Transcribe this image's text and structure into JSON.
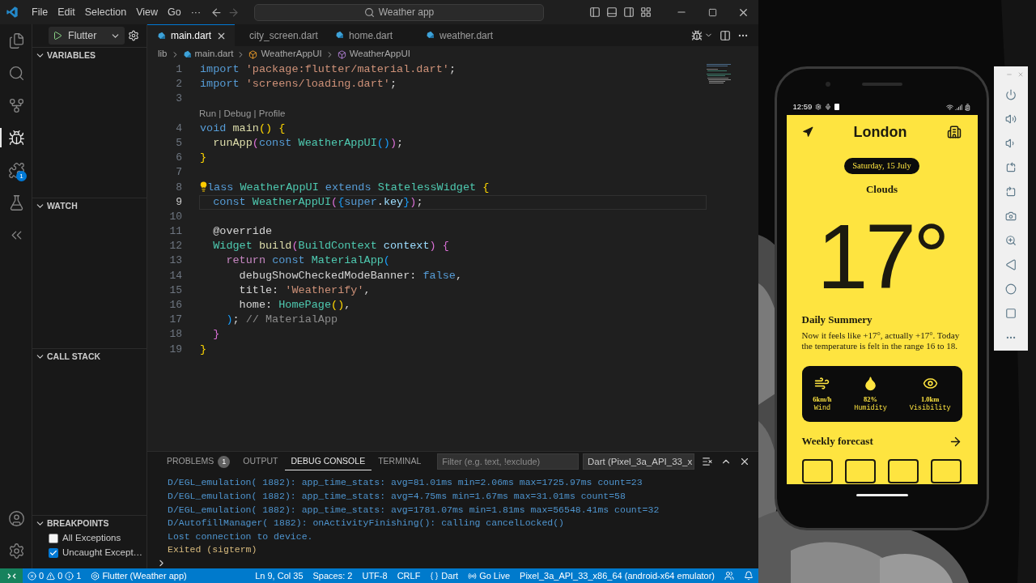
{
  "title_bar": {
    "menus": [
      "File",
      "Edit",
      "Selection",
      "View",
      "Go",
      "···"
    ],
    "search": "Weather app"
  },
  "activity_bar": {
    "top": [
      {
        "kind": "files",
        "selected": false
      },
      {
        "kind": "search",
        "selected": false
      },
      {
        "kind": "source_control",
        "selected": false
      },
      {
        "kind": "debug",
        "selected": true
      },
      {
        "kind": "extensions",
        "selected": false,
        "badge": "1"
      },
      {
        "kind": "testing",
        "selected": false
      },
      {
        "kind": "flutter",
        "selected": false
      }
    ],
    "bottom": [
      {
        "kind": "account"
      },
      {
        "kind": "settings"
      }
    ]
  },
  "sidebar": {
    "run_config": "Flutter",
    "sections": [
      {
        "title": "VARIABLES",
        "expanded": true
      },
      {
        "title": "WATCH",
        "expanded": true
      },
      {
        "title": "CALL STACK",
        "expanded": true
      },
      {
        "title": "BREAKPOINTS",
        "expanded": true
      }
    ],
    "breakpoints": [
      {
        "label": "All Exceptions",
        "checked": false
      },
      {
        "label": "Uncaught Except…",
        "checked": true
      }
    ]
  },
  "editor": {
    "tabs": [
      {
        "label": "main.dart",
        "selected": true
      },
      {
        "label": "city_screen.dart",
        "selected": false
      },
      {
        "label": "home.dart",
        "selected": false
      },
      {
        "label": "weather.dart",
        "selected": false
      }
    ],
    "breadcrumbs": [
      {
        "text": "lib",
        "kind": "folder"
      },
      {
        "text": "main.dart",
        "kind": "file"
      },
      {
        "text": "WeatherAppUI",
        "kind": "class"
      },
      {
        "text": "WeatherAppUI",
        "kind": "method"
      }
    ],
    "lines": [
      {
        "kind": "code",
        "n": "1",
        "current": false,
        "bulb": false,
        "tokens": [
          {
            "text": "import ",
            "kind": "kw"
          },
          {
            "text": "'package:flutter/material.dart'",
            "kind": "str"
          },
          {
            "text": ";",
            "kind": "plain"
          }
        ]
      },
      {
        "kind": "code",
        "n": "2",
        "current": false,
        "bulb": false,
        "tokens": [
          {
            "text": "import ",
            "kind": "kw"
          },
          {
            "text": "'screens/loading.dart'",
            "kind": "str"
          },
          {
            "text": ";",
            "kind": "plain"
          }
        ]
      },
      {
        "kind": "code",
        "n": "3",
        "current": false,
        "bulb": false
      },
      {
        "kind": "codelens",
        "text": "Run | Debug | Profile"
      },
      {
        "kind": "code",
        "n": "4",
        "current": false,
        "bulb": false,
        "tokens": [
          {
            "text": "void ",
            "kind": "kw"
          },
          {
            "text": "main",
            "kind": "fn"
          },
          {
            "text": "() {",
            "kind": "p1"
          }
        ]
      },
      {
        "kind": "code",
        "n": "5",
        "current": false,
        "bulb": false,
        "tokens": [
          {
            "text": "  runApp",
            "kind": "fn"
          },
          {
            "text": "(",
            "kind": "p2"
          },
          {
            "text": "const ",
            "kind": "kw"
          },
          {
            "text": "WeatherAppUI",
            "kind": "type"
          },
          {
            "text": "()",
            "kind": "p3"
          },
          {
            "text": ")",
            "kind": "p2"
          },
          {
            "text": ";",
            "kind": "plain"
          }
        ]
      },
      {
        "kind": "code",
        "n": "6",
        "current": false,
        "bulb": false,
        "tokens": [
          {
            "text": "}",
            "kind": "p1"
          }
        ]
      },
      {
        "kind": "code",
        "n": "7",
        "current": false,
        "bulb": false
      },
      {
        "kind": "code",
        "n": "8",
        "current": false,
        "bulb": true,
        "tokens": [
          {
            "text": "lass ",
            "kind": "kw"
          },
          {
            "text": "WeatherAppUI ",
            "kind": "type"
          },
          {
            "text": "extends ",
            "kind": "kw"
          },
          {
            "text": "StatelessWidget ",
            "kind": "type"
          },
          {
            "text": "{",
            "kind": "p1"
          }
        ]
      },
      {
        "kind": "code",
        "n": "9",
        "current": true,
        "bulb": false,
        "tokens": [
          {
            "text": "  const ",
            "kind": "kw"
          },
          {
            "text": "WeatherAppUI",
            "kind": "type"
          },
          {
            "text": "(",
            "kind": "p2"
          },
          {
            "text": "{",
            "kind": "p3"
          },
          {
            "text": "super",
            "kind": "kw"
          },
          {
            "text": ".",
            "kind": "plain"
          },
          {
            "text": "key",
            "kind": "var"
          },
          {
            "text": "}",
            "kind": "p3"
          },
          {
            "text": ")",
            "kind": "p2"
          },
          {
            "text": ";",
            "kind": "plain"
          }
        ]
      },
      {
        "kind": "code",
        "n": "10",
        "current": false,
        "bulb": false
      },
      {
        "kind": "code",
        "n": "11",
        "current": false,
        "bulb": false,
        "tokens": [
          {
            "text": "  @override",
            "kind": "plain"
          }
        ]
      },
      {
        "kind": "code",
        "n": "12",
        "current": false,
        "bulb": false,
        "tokens": [
          {
            "text": "  Widget ",
            "kind": "type"
          },
          {
            "text": "build",
            "kind": "fn"
          },
          {
            "text": "(",
            "kind": "p2"
          },
          {
            "text": "BuildContext",
            "kind": "type"
          },
          {
            "text": " context",
            "kind": "var"
          },
          {
            "text": ") {",
            "kind": "p2"
          }
        ]
      },
      {
        "kind": "code",
        "n": "13",
        "current": false,
        "bulb": false,
        "tokens": [
          {
            "text": "    return ",
            "kind": "ctrl"
          },
          {
            "text": "const ",
            "kind": "kw"
          },
          {
            "text": "MaterialApp",
            "kind": "type"
          },
          {
            "text": "(",
            "kind": "p3"
          }
        ]
      },
      {
        "kind": "code",
        "n": "14",
        "current": false,
        "bulb": false,
        "tokens": [
          {
            "text": "      debugShowCheckedModeBanner: ",
            "kind": "plain"
          },
          {
            "text": "false",
            "kind": "kw"
          },
          {
            "text": ",",
            "kind": "plain"
          }
        ]
      },
      {
        "kind": "code",
        "n": "15",
        "current": false,
        "bulb": false,
        "tokens": [
          {
            "text": "      title: ",
            "kind": "plain"
          },
          {
            "text": "'Weatherify'",
            "kind": "str"
          },
          {
            "text": ",",
            "kind": "plain"
          }
        ]
      },
      {
        "kind": "code",
        "n": "16",
        "current": false,
        "bulb": false,
        "tokens": [
          {
            "text": "      home: ",
            "kind": "plain"
          },
          {
            "text": "HomePage",
            "kind": "type"
          },
          {
            "text": "()",
            "kind": "p1"
          },
          {
            "text": ",",
            "kind": "plain"
          }
        ]
      },
      {
        "kind": "code",
        "n": "17",
        "current": false,
        "bulb": false,
        "tokens": [
          {
            "text": "    )",
            "kind": "p3"
          },
          {
            "text": "; ",
            "kind": "plain"
          },
          {
            "text": "// MaterialApp",
            "kind": "comment"
          }
        ]
      },
      {
        "kind": "code",
        "n": "18",
        "current": false,
        "bulb": false,
        "tokens": [
          {
            "text": "  }",
            "kind": "p2"
          }
        ]
      },
      {
        "kind": "code",
        "n": "19",
        "current": false,
        "bulb": false,
        "tokens": [
          {
            "text": "}",
            "kind": "p1"
          }
        ]
      }
    ]
  },
  "panel": {
    "tabs": [
      {
        "label": "PROBLEMS",
        "selected": false,
        "badge": "1"
      },
      {
        "label": "OUTPUT",
        "selected": false
      },
      {
        "label": "DEBUG CONSOLE",
        "selected": true
      },
      {
        "label": "TERMINAL",
        "selected": false
      }
    ],
    "filter_placeholder": "Filter (e.g. text, !exclude)",
    "session": "Dart (Pixel_3a_API_33_x",
    "console": [
      {
        "text": "D/EGL_emulation( 1882): app_time_stats: avg=81.01ms min=2.06ms max=1725.97ms count=23",
        "kind": "log"
      },
      {
        "text": "D/EGL_emulation( 1882): app_time_stats: avg=4.75ms min=1.67ms max=31.01ms count=58",
        "kind": "log"
      },
      {
        "text": "D/EGL_emulation( 1882): app_time_stats: avg=1781.07ms min=1.81ms max=56548.41ms count=32",
        "kind": "log"
      },
      {
        "text": "D/AutofillManager( 1882): onActivityFinishing(): calling cancelLocked()",
        "kind": "log"
      },
      {
        "text": "Lost connection to device.",
        "kind": "log"
      },
      {
        "text": "Exited (sigterm)",
        "kind": "warn"
      }
    ]
  },
  "status_bar": {
    "errors": "0",
    "warnings": "0",
    "infos": "1",
    "debug_target": "Flutter (Weather app)",
    "right": [
      {
        "kind": "text",
        "text": "Ln 9, Col 35"
      },
      {
        "kind": "text",
        "text": "Spaces: 2"
      },
      {
        "kind": "text",
        "text": "UTF-8"
      },
      {
        "kind": "text",
        "text": "CRLF"
      },
      {
        "kind": "language",
        "text": "Dart"
      },
      {
        "kind": "live",
        "text": "Go Live"
      },
      {
        "kind": "text",
        "text": "Pixel_3a_API_33_x86_64 (android-x64 emulator)"
      }
    ]
  },
  "phone": {
    "time": "12:59",
    "city": "London",
    "date": "Saturday, 15 July",
    "condition": "Clouds",
    "temperature": "17°",
    "summary_title": "Daily Summery",
    "summary": "Now it feels like +17°, actually +17°. Today the temperature is felt in the range 16 to 18.",
    "stats": [
      {
        "kind": "wind",
        "value": "6km/h",
        "label": "Wind"
      },
      {
        "kind": "humidity",
        "value": "82%",
        "label": "Humidity"
      },
      {
        "kind": "visibility",
        "value": "1.0km",
        "label": "Visibility"
      }
    ],
    "forecast_title": "Weekly forecast",
    "forecast_cards": [
      {
        "kind": "empty"
      },
      {
        "kind": "empty"
      },
      {
        "kind": "empty"
      },
      {
        "kind": "empty"
      }
    ]
  },
  "emulator_toolbar": [
    {
      "kind": "power"
    },
    {
      "kind": "volume_up"
    },
    {
      "kind": "volume_down"
    },
    {
      "kind": "rotate_left"
    },
    {
      "kind": "rotate_right"
    },
    {
      "kind": "camera"
    },
    {
      "kind": "zoom"
    },
    {
      "kind": "back"
    },
    {
      "kind": "home"
    },
    {
      "kind": "overview"
    },
    {
      "kind": "more"
    }
  ]
}
